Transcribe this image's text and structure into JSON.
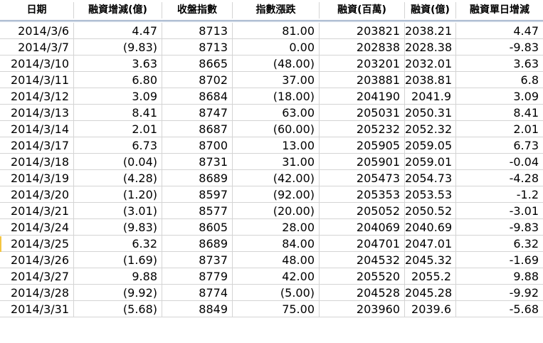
{
  "headers": [
    "日期",
    "融資增減(億)",
    "收盤指數",
    "指數漲跌",
    "融資(百萬)",
    "融資(億)",
    "融資單日增減"
  ],
  "rows": [
    {
      "date": "2014/3/6",
      "change": "4.47",
      "change_neg": false,
      "close": "8713",
      "diff": "81.00",
      "diff_neg": false,
      "margin_m": "203821",
      "margin_b": "2038.21",
      "daily": "4.47"
    },
    {
      "date": "2014/3/7",
      "change": "(9.83)",
      "change_neg": true,
      "close": "8713",
      "diff": "0.00",
      "diff_neg": false,
      "margin_m": "202838",
      "margin_b": "2028.38",
      "daily": "-9.83"
    },
    {
      "date": "2014/3/10",
      "change": "3.63",
      "change_neg": false,
      "close": "8665",
      "diff": "(48.00)",
      "diff_neg": true,
      "margin_m": "203201",
      "margin_b": "2032.01",
      "daily": "3.63"
    },
    {
      "date": "2014/3/11",
      "change": "6.80",
      "change_neg": false,
      "close": "8702",
      "diff": "37.00",
      "diff_neg": false,
      "margin_m": "203881",
      "margin_b": "2038.81",
      "daily": "6.8"
    },
    {
      "date": "2014/3/12",
      "change": "3.09",
      "change_neg": false,
      "close": "8684",
      "diff": "(18.00)",
      "diff_neg": true,
      "margin_m": "204190",
      "margin_b": "2041.9",
      "daily": "3.09"
    },
    {
      "date": "2014/3/13",
      "change": "8.41",
      "change_neg": false,
      "close": "8747",
      "diff": "63.00",
      "diff_neg": false,
      "margin_m": "205031",
      "margin_b": "2050.31",
      "daily": "8.41"
    },
    {
      "date": "2014/3/14",
      "change": "2.01",
      "change_neg": false,
      "close": "8687",
      "diff": "(60.00)",
      "diff_neg": true,
      "margin_m": "205232",
      "margin_b": "2052.32",
      "daily": "2.01"
    },
    {
      "date": "2014/3/17",
      "change": "6.73",
      "change_neg": false,
      "close": "8700",
      "diff": "13.00",
      "diff_neg": false,
      "margin_m": "205905",
      "margin_b": "2059.05",
      "daily": "6.73"
    },
    {
      "date": "2014/3/18",
      "change": "(0.04)",
      "change_neg": true,
      "close": "8731",
      "diff": "31.00",
      "diff_neg": false,
      "margin_m": "205901",
      "margin_b": "2059.01",
      "daily": "-0.04"
    },
    {
      "date": "2014/3/19",
      "change": "(4.28)",
      "change_neg": true,
      "close": "8689",
      "diff": "(42.00)",
      "diff_neg": true,
      "margin_m": "205473",
      "margin_b": "2054.73",
      "daily": "-4.28"
    },
    {
      "date": "2014/3/20",
      "change": "(1.20)",
      "change_neg": true,
      "close": "8597",
      "diff": "(92.00)",
      "diff_neg": true,
      "margin_m": "205353",
      "margin_b": "2053.53",
      "daily": "-1.2"
    },
    {
      "date": "2014/3/21",
      "change": "(3.01)",
      "change_neg": true,
      "close": "8577",
      "diff": "(20.00)",
      "diff_neg": true,
      "margin_m": "205052",
      "margin_b": "2050.52",
      "daily": "-3.01"
    },
    {
      "date": "2014/3/24",
      "change": "(9.83)",
      "change_neg": true,
      "close": "8605",
      "diff": "28.00",
      "diff_neg": false,
      "margin_m": "204069",
      "margin_b": "2040.69",
      "daily": "-9.83"
    },
    {
      "date": "2014/3/25",
      "change": "6.32",
      "change_neg": false,
      "close": "8689",
      "diff": "84.00",
      "diff_neg": false,
      "margin_m": "204701",
      "margin_b": "2047.01",
      "daily": "6.32"
    },
    {
      "date": "2014/3/26",
      "change": "(1.69)",
      "change_neg": true,
      "close": "8737",
      "diff": "48.00",
      "diff_neg": false,
      "margin_m": "204532",
      "margin_b": "2045.32",
      "daily": "-1.69"
    },
    {
      "date": "2014/3/27",
      "change": "9.88",
      "change_neg": false,
      "close": "8779",
      "diff": "42.00",
      "diff_neg": false,
      "margin_m": "205520",
      "margin_b": "2055.2",
      "daily": "9.88"
    },
    {
      "date": "2014/3/28",
      "change": "(9.92)",
      "change_neg": true,
      "close": "8774",
      "diff": "(5.00)",
      "diff_neg": true,
      "margin_m": "204528",
      "margin_b": "2045.28",
      "daily": "-9.92"
    },
    {
      "date": "2014/3/31",
      "change": "(5.68)",
      "change_neg": true,
      "close": "8849",
      "diff": "75.00",
      "diff_neg": false,
      "margin_m": "203960",
      "margin_b": "2039.6",
      "daily": "-5.68"
    }
  ],
  "colors": {
    "negative": "#e00000",
    "text": "#000000",
    "grid": "#d4d4d4",
    "header_separator": "#c9d3e2"
  }
}
